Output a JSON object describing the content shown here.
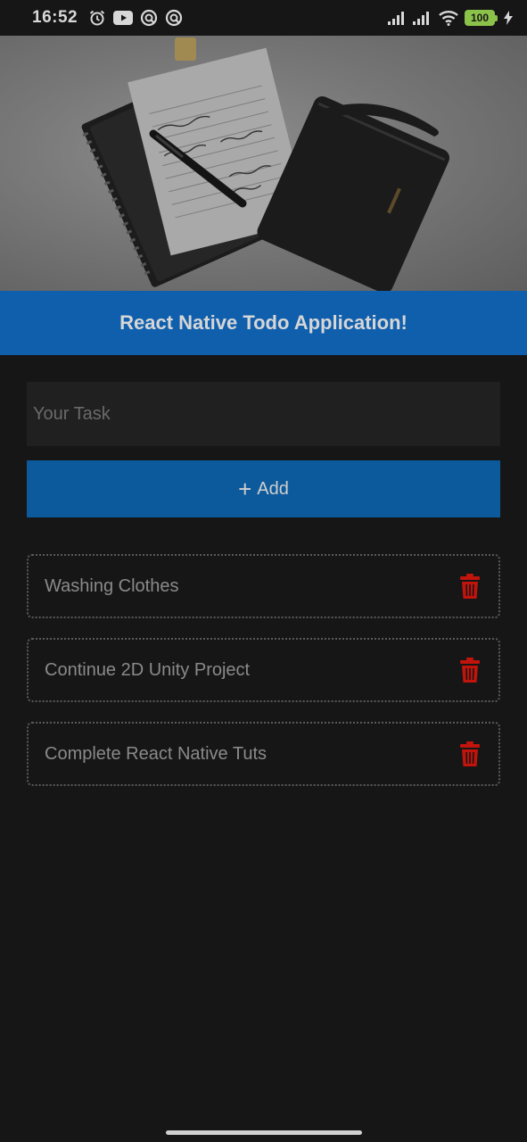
{
  "status_bar": {
    "time": "16:52",
    "battery": "100",
    "icons": [
      "alarm-icon",
      "youtube-icon",
      "app-icon",
      "app-icon",
      "signal-icon",
      "signal-icon",
      "wifi-icon",
      "battery-icon",
      "charging-icon"
    ]
  },
  "header": {
    "title": "React Native Todo Application!"
  },
  "input": {
    "placeholder": "Your Task",
    "value": ""
  },
  "add_button": {
    "icon": "+",
    "label": "Add"
  },
  "tasks": [
    {
      "text": "Washing Clothes"
    },
    {
      "text": "Continue 2D Unity Project"
    },
    {
      "text": "Complete React Native Tuts"
    }
  ],
  "colors": {
    "background": "#161616",
    "header": "#0f5fad",
    "button": "#0c5a9b",
    "delete": "#c0140c",
    "battery": "#8bc34a"
  }
}
